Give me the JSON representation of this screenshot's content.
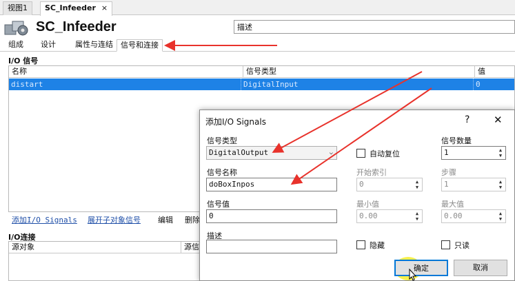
{
  "doc_tabs": [
    {
      "label": "视图1"
    },
    {
      "label": "SC_Infeeder",
      "close": "×"
    }
  ],
  "header": {
    "title": "SC_Infeeder",
    "description_value": "描述"
  },
  "sub_tabs": [
    "组成",
    "设计",
    "属性与连结",
    "信号和连接"
  ],
  "io_signals": {
    "title": "I/O 信号",
    "columns": [
      "名称",
      "信号类型",
      "值"
    ],
    "rows": [
      {
        "name": "distart",
        "type": "DigitalInput",
        "value": "0"
      }
    ]
  },
  "actions": [
    "添加I/O Signals",
    "展开子对象信号",
    "编辑",
    "删除"
  ],
  "io_connections": {
    "title": "I/O连接",
    "columns": [
      "源对象",
      "源信"
    ]
  },
  "dialog": {
    "title": "添加I/O Signals",
    "help": "?",
    "close": "✕",
    "signal_type_label": "信号类型",
    "signal_type_value": "DigitalOutput",
    "auto_reset_label": "自动复位",
    "signal_count_label": "信号数量",
    "signal_count_value": "1",
    "signal_name_label": "信号名称",
    "signal_name_value": "doBoxInpos",
    "start_index_label": "开始索引",
    "start_index_value": "0",
    "step_label": "步骤",
    "step_value": "1",
    "signal_value_label": "信号值",
    "signal_value_value": "0",
    "min_label": "最小值",
    "min_value": "0.00",
    "max_label": "最大值",
    "max_value": "0.00",
    "description_label": "描述",
    "description_value": "",
    "hidden_label": "隐藏",
    "readonly_label": "只读",
    "ok_label": "确定",
    "cancel_label": "取消"
  },
  "colors": {
    "selection": "#1e82e6",
    "annotation_arrow": "#e8322b",
    "cursor_highlight": "#f6ee3a",
    "primary_button_border": "#0078d7"
  }
}
